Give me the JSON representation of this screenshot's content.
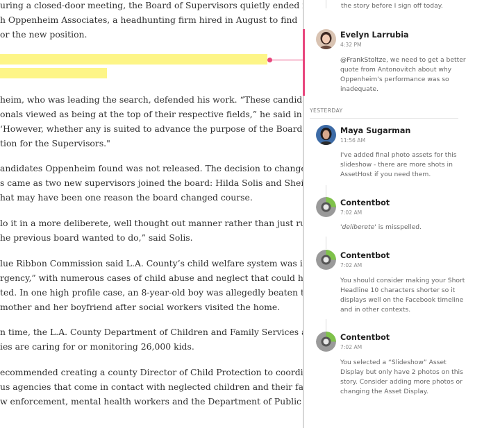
{
  "article": {
    "paragraphs": [
      [
        "uring a closed-door meeting, the Board of Supervisors quietly ended its",
        "h Oppenheim Associates, a headhunting firm hired in August to find",
        "or the new position."
      ],
      [
        "heim, who was leading the search, defended his work. “These candidates",
        "onals viewed as being at the top of their respective fields,” he said in a",
        "‘However, whether any is suited to advance the purpose of the Board is",
        "tion for the Supervisors.\""
      ],
      [
        "andidates Oppenheim found was not released. The decision to change",
        "s came as two new supervisors joined the board: Hilda Solis and Sheila",
        "hat may have been one reason the board changed course."
      ],
      [
        "lo it in a more deliberete, well thought out manner rather than just rushing",
        "he previous board wanted to do,” said Solis."
      ],
      [
        "lue Ribbon Commission said L.A. County’s child welfare system was in “a",
        "rgency,” with numerous cases of child abuse and neglect that could have",
        "ted. In one high profile case, an 8-year-old boy was allegedly beaten to",
        " mother and her boyfriend after social workers visited the home."
      ],
      [
        "n time, the L.A. County Department of Children and Family Services and",
        "ies are caring for or monitoring 26,000 kids."
      ],
      [
        "ecommended creating a county Director of Child Protection to coordinate",
        "us agencies that come in contact with neglected children and their families,",
        "w enforcement, mental health workers and the Department of Public Social"
      ]
    ]
  },
  "comments": {
    "top_partial": "the story before I sign off today.",
    "day_label": "YESTERDAY",
    "items": [
      {
        "author": "Evelyn Larrubia",
        "time": "4:32 PM",
        "mention": "@FrankStoltze",
        "lines": [
          ", we need to get a better",
          "quote from Antonovitch about why",
          "Oppenheim's performance was so",
          "inadequate."
        ]
      },
      {
        "author": "Maya Sugarman",
        "time": "11:56 AM",
        "lines": [
          "I've added final photo assets for this",
          "slideshow - there are more shots in",
          "AssetHost if you need them."
        ]
      },
      {
        "author": "Contentbot",
        "time": "7:02 AM",
        "quoted": "'deliberete'",
        "lines": [
          " is misspelled."
        ]
      },
      {
        "author": "Contentbot",
        "time": "7:02 AM",
        "lines": [
          "You should consider making your Short",
          "Headline 10 characters shorter so it",
          "displays well on the Facebook timeline",
          "and in other contexts."
        ]
      },
      {
        "author": "Contentbot",
        "time": "7:02 AM",
        "lines": [
          "You selected a “Slideshow” Asset",
          "Display but only have 2 photos on this",
          "story. Consider adding more photos or",
          "changing the Asset Display."
        ]
      }
    ]
  },
  "colors": {
    "highlight": "#fdf587",
    "accent": "#e8477d",
    "bot": "#7fc24a"
  }
}
